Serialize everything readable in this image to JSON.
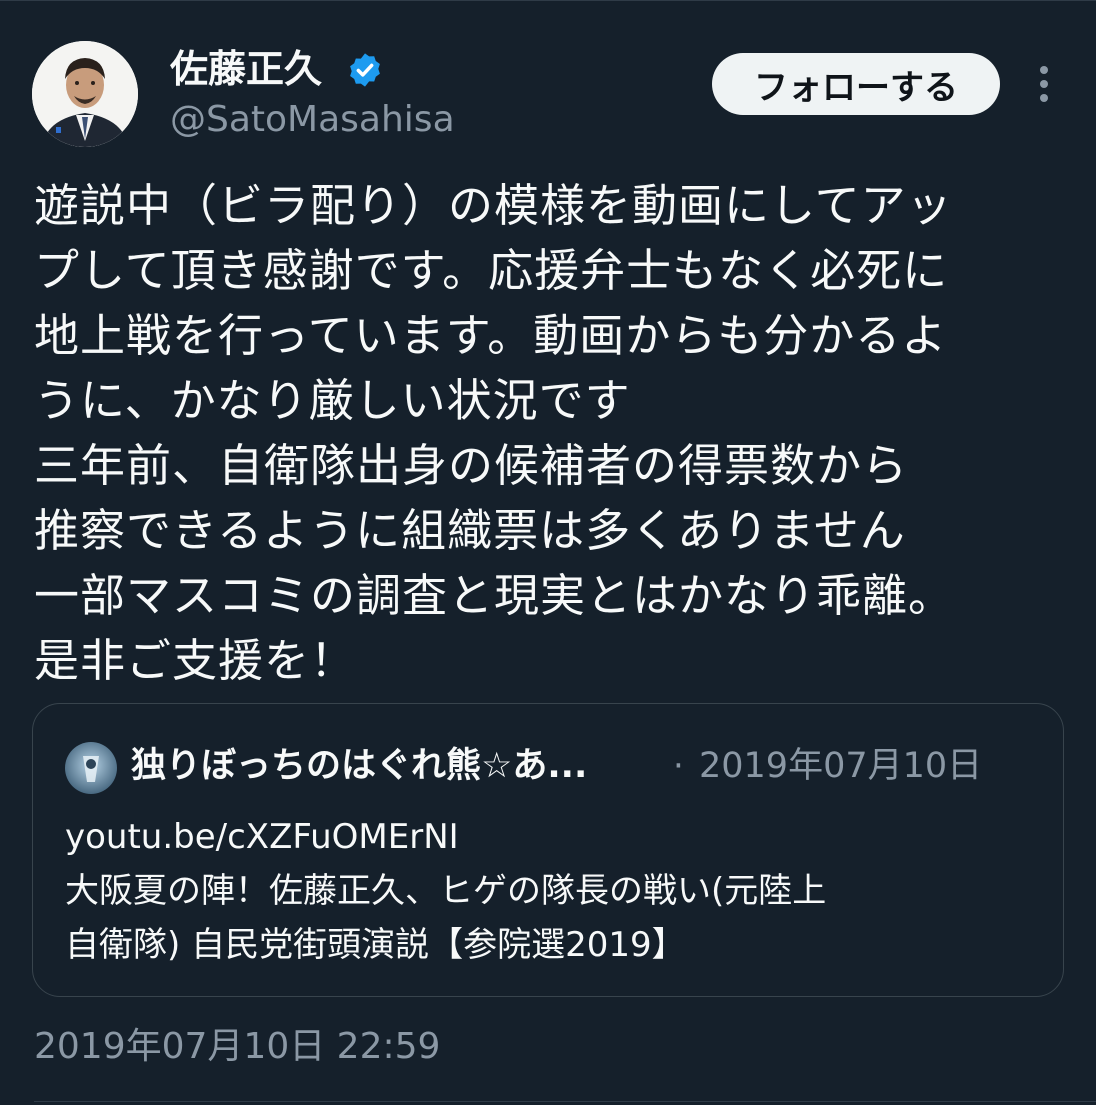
{
  "author": {
    "display_name": "佐藤正久",
    "handle": "@SatoMasahisa",
    "verified_icon": "verified-badge-icon"
  },
  "actions": {
    "follow_label": "フォローする",
    "more_icon": "more-options-icon"
  },
  "tweet": {
    "lines": [
      "遊説中（ビラ配り）の模様を動画にしてアッ",
      "プして頂き感謝です。応援弁士もなく必死に",
      "地上戦を行っています。動画からも分かるよ",
      "うに、かなり厳しい状況です",
      "三年前、自衛隊出身の候補者の得票数から",
      "推察できるように組織票は多くありません",
      "一部マスコミの調査と現実とはかなり乖離。",
      "是非ご支援を！"
    ],
    "timestamp": "2019年07月10日 22:59"
  },
  "quote": {
    "author_name": "独りぼっちのはぐれ熊☆あ...",
    "separator": "·",
    "date": "2019年07月10日",
    "link": "youtu.be/cXZFuOMErNI",
    "title_lines": [
      "大阪夏の陣！佐藤正久、ヒゲの隊長の戦い(元陸上",
      "自衛隊) 自民党街頭演説【参院選2019】"
    ]
  },
  "colors": {
    "background": "#15202b",
    "text_primary": "#f7f9f9",
    "text_secondary": "#8b98a5",
    "verified_blue": "#1d9bf0",
    "border": "#38444d"
  }
}
